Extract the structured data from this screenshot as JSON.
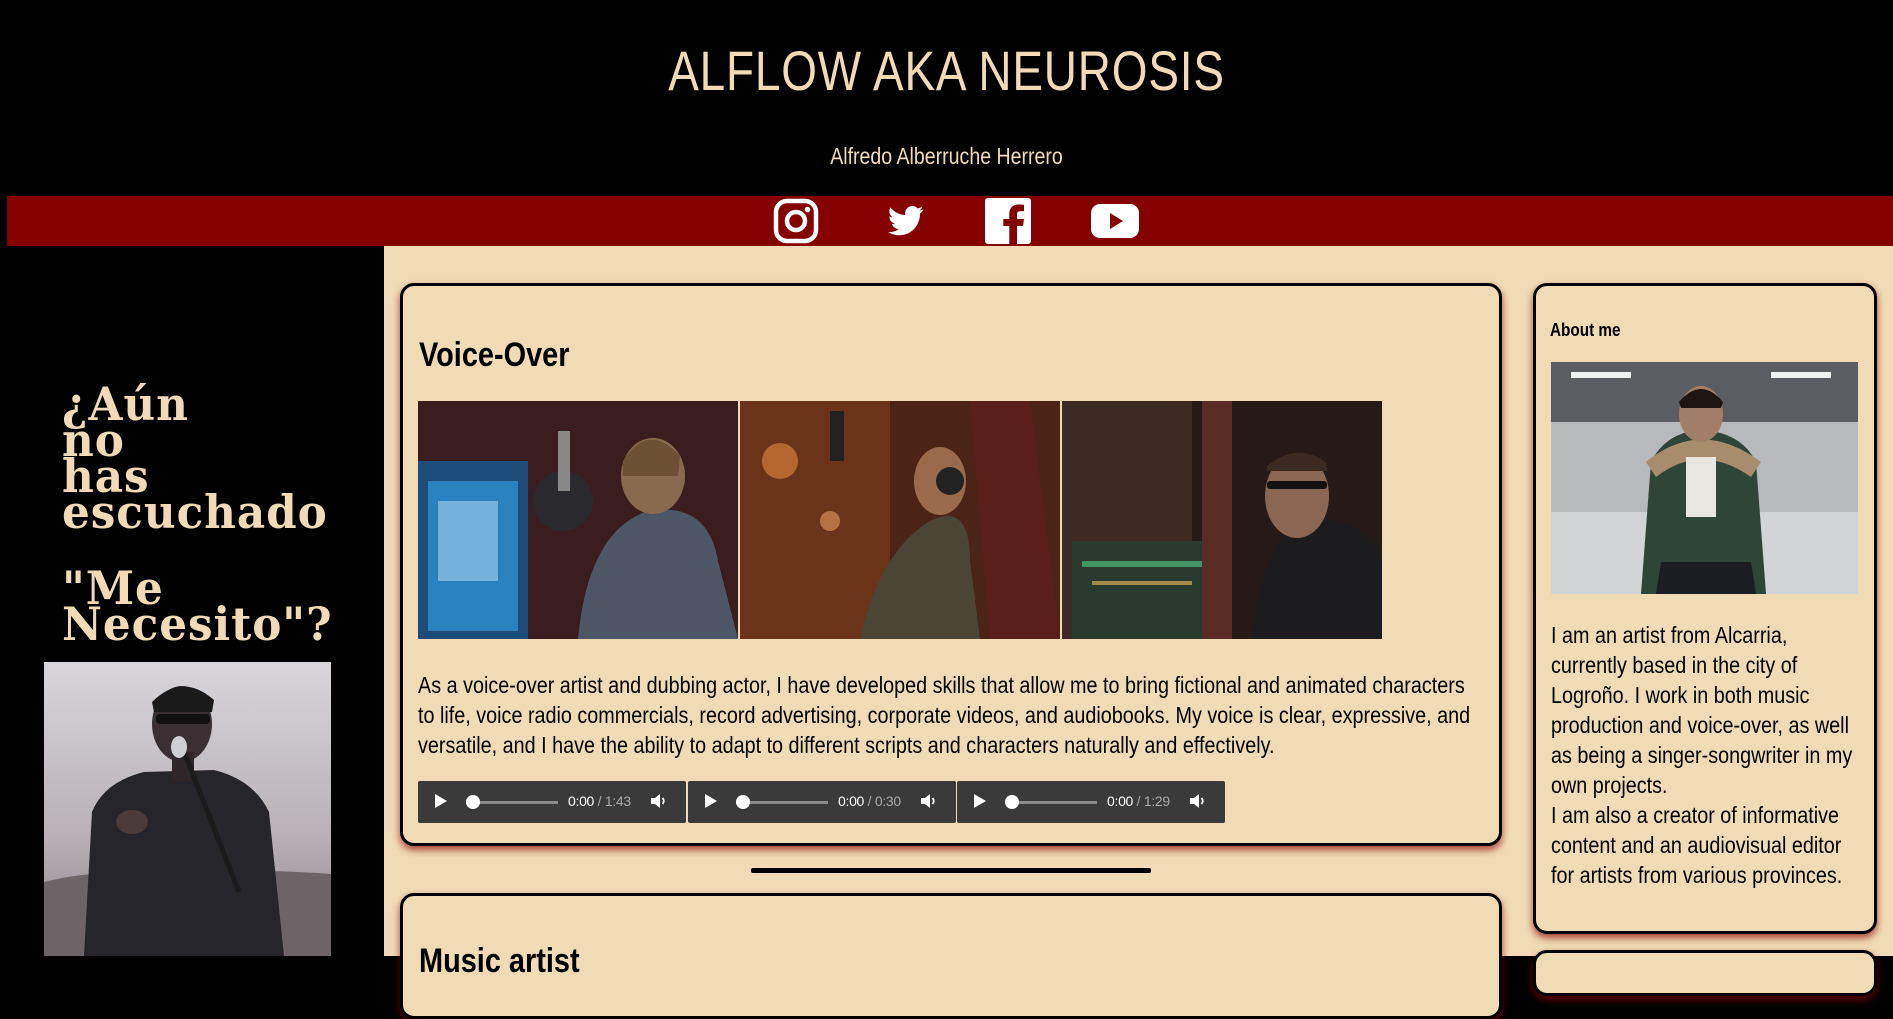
{
  "header": {
    "title": "ALFLOW AKA NEUROSIS",
    "subtitle": "Alfredo Alberruche Herrero"
  },
  "social": [
    {
      "name": "instagram-icon"
    },
    {
      "name": "twitter-icon"
    },
    {
      "name": "facebook-icon"
    },
    {
      "name": "youtube-icon"
    }
  ],
  "promo": {
    "lines": [
      "¿Aún",
      "no",
      "has",
      "escuchado",
      "\"Me",
      "Necesito\"?"
    ]
  },
  "voiceover": {
    "title": "Voice-Over",
    "description": "As a voice-over artist and dubbing actor, I have developed skills that allow me to bring fictional and animated characters to life, voice radio commercials, record advertising, corporate videos, and audiobooks. My voice is clear, expressive, and versatile, and I have the ability to adapt to different scripts and characters naturally and effectively.",
    "description_lines": [
      "As a voice-over artist and dubbing actor, I have developed skills that allow me to bring fictional and animated characters",
      "to life, voice radio commercials, record advertising, corporate videos, and audiobooks. My voice is clear, expressive, and",
      "versatile, and I have the ability to adapt to different scripts and characters naturally and effectively."
    ],
    "players": [
      {
        "current": "0:00",
        "duration": "1:43"
      },
      {
        "current": "0:00",
        "duration": "0:30"
      },
      {
        "current": "0:00",
        "duration": "1:29"
      }
    ]
  },
  "music": {
    "title": "Music artist"
  },
  "about": {
    "title": "About me",
    "lines": [
      "I am an artist from Alcarria,",
      "currently based in the city of",
      "Logroño. I work in both music",
      "production and voice-over, as well",
      "as being a singer-songwriter in my",
      "own projects.",
      "I am also a creator of informative",
      "content and an audiovisual editor",
      "for artists from various provinces."
    ]
  },
  "colors": {
    "background": "#000000",
    "accent_red": "#850000",
    "cream": "#f1dbb6",
    "text_dark": "#000000"
  }
}
